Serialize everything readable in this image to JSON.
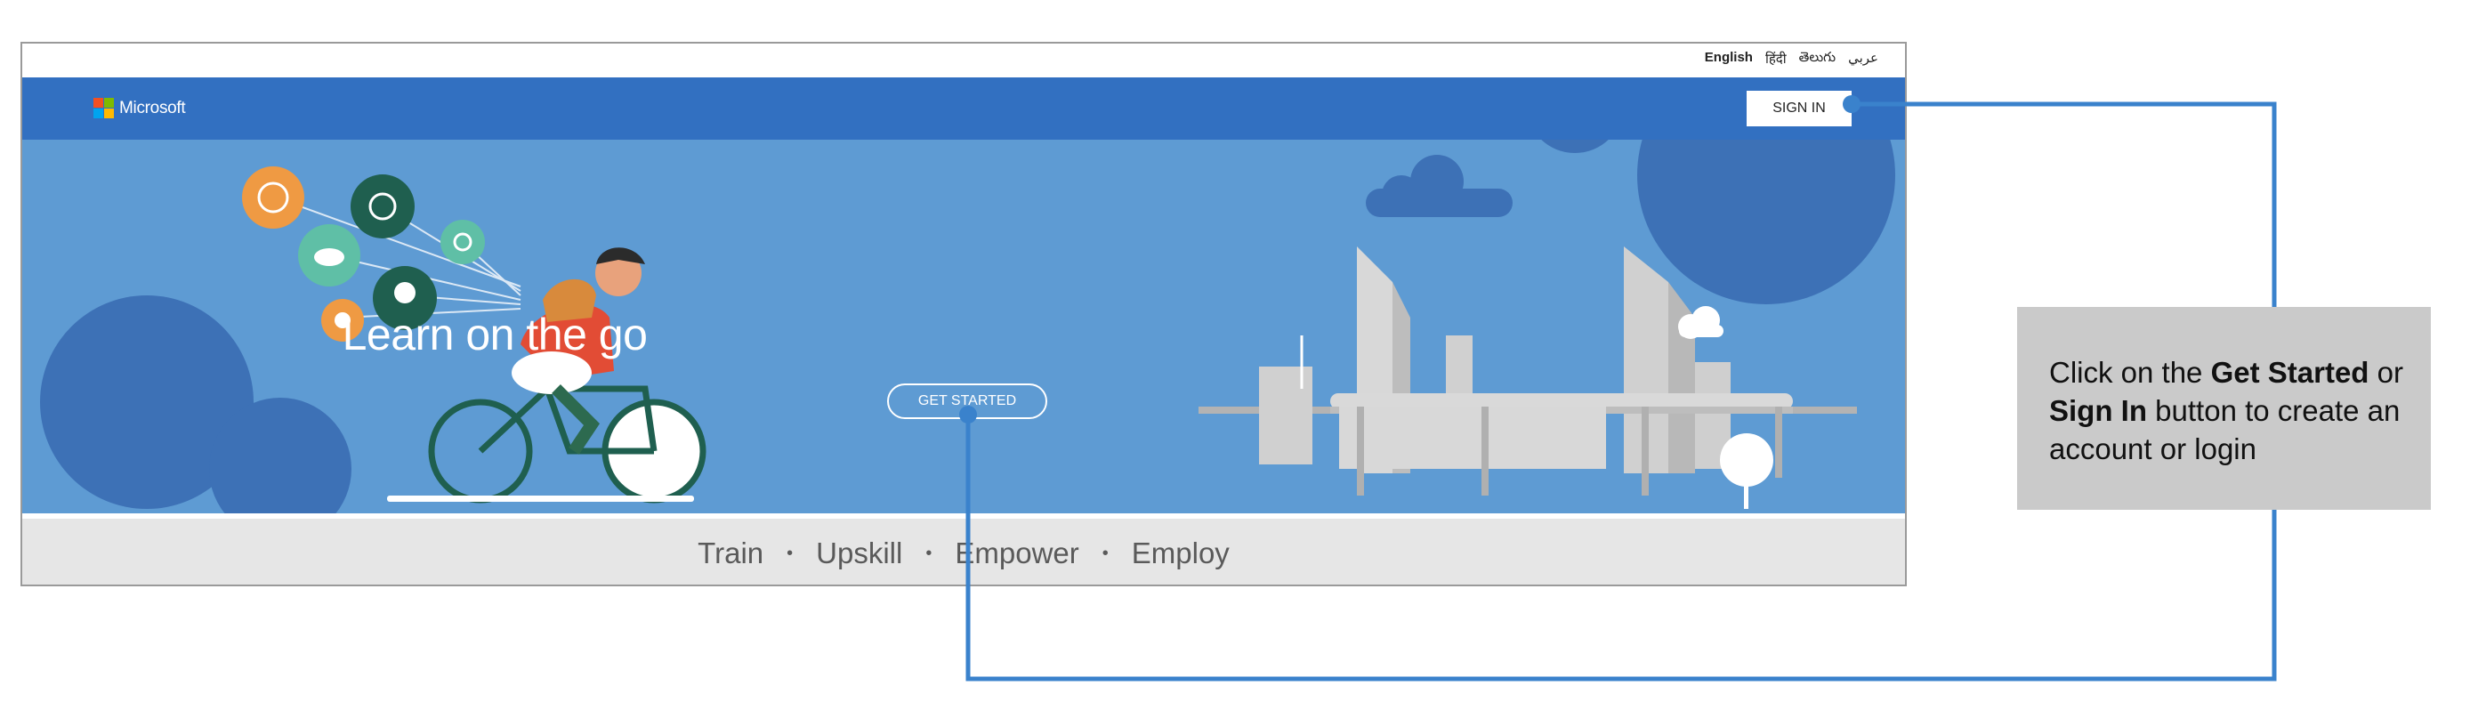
{
  "languages": [
    "English",
    "हिंदी",
    "తెలుగు",
    "عربي"
  ],
  "navbar": {
    "logo_text": "Microsoft",
    "signin_label": "SIGN IN",
    "color": "#3270c1"
  },
  "hero": {
    "title": "Learn on the go",
    "cta_label": "GET STARTED",
    "background": "#5e9bd3"
  },
  "tagline": {
    "items": [
      "Train",
      "Upskill",
      "Empower",
      "Employ"
    ],
    "separator": "•"
  },
  "callout": {
    "part1": "Click on the ",
    "bold1": "Get Started",
    "part2": " or ",
    "bold2": "Sign In",
    "part3": " button to create an account or login"
  },
  "colors": {
    "connector": "#3a82cc",
    "callout_bg": "#cacaca"
  }
}
